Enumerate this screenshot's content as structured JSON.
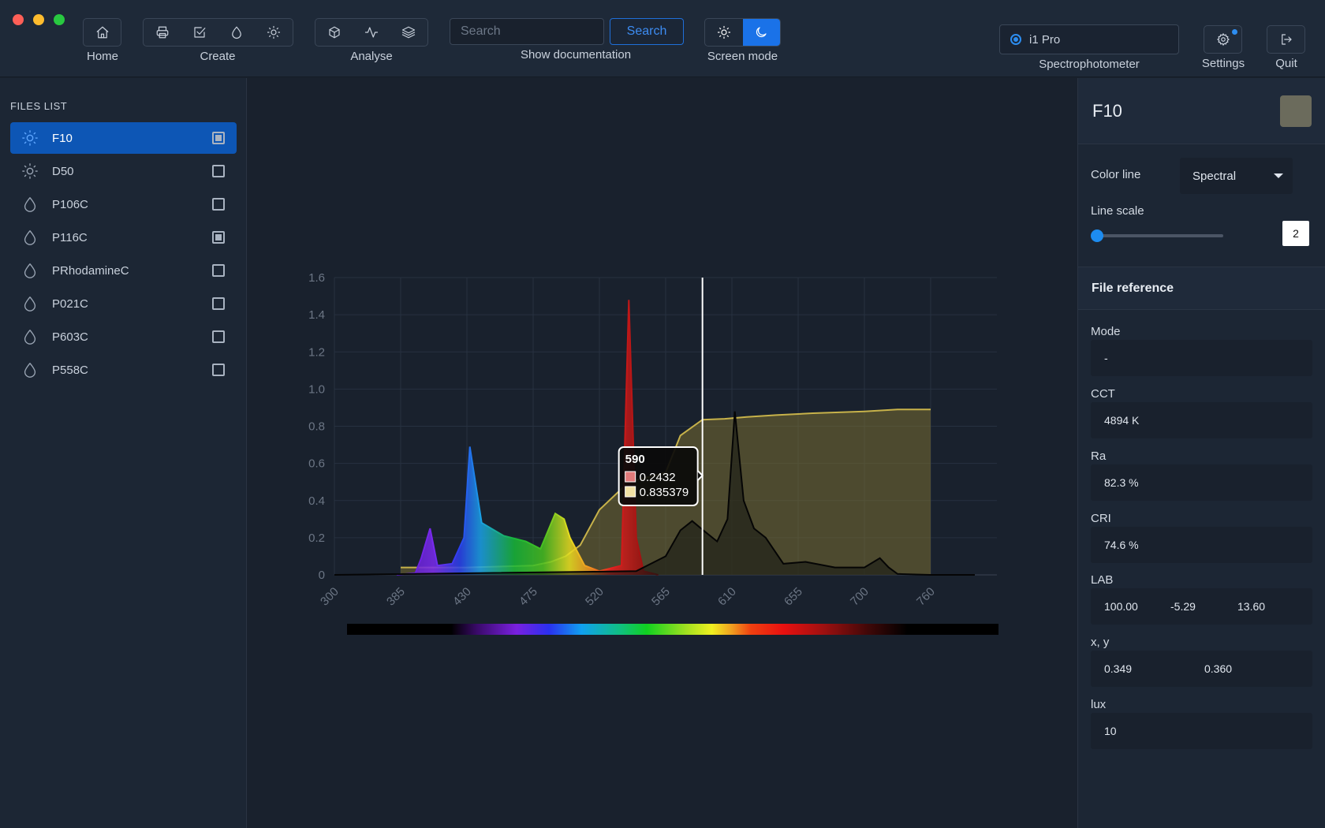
{
  "toolbar": {
    "home_label": "Home",
    "create_label": "Create",
    "analyse_label": "Analyse",
    "search_placeholder": "Search",
    "search_button": "Search",
    "show_doc_label": "Show documentation",
    "screen_mode_label": "Screen mode",
    "device_value": "i1 Pro",
    "device_label": "Spectrophotometer",
    "settings_label": "Settings",
    "quit_label": "Quit"
  },
  "sidebar": {
    "title": "FILES LIST",
    "items": [
      {
        "name": "F10",
        "icon": "sun-icon",
        "checked": true,
        "active": true
      },
      {
        "name": "D50",
        "icon": "sun-icon",
        "checked": false,
        "active": false
      },
      {
        "name": "P106C",
        "icon": "drop-icon",
        "checked": false,
        "active": false
      },
      {
        "name": "P116C",
        "icon": "drop-icon",
        "checked": true,
        "active": false
      },
      {
        "name": "PRhodamineC",
        "icon": "drop-icon",
        "checked": false,
        "active": false
      },
      {
        "name": "P021C",
        "icon": "drop-icon",
        "checked": false,
        "active": false
      },
      {
        "name": "P603C",
        "icon": "drop-icon",
        "checked": false,
        "active": false
      },
      {
        "name": "P558C",
        "icon": "drop-icon",
        "checked": false,
        "active": false
      }
    ]
  },
  "chart_data": {
    "type": "area",
    "x_ticks": [
      "300",
      "385",
      "430",
      "475",
      "520",
      "565",
      "610",
      "655",
      "700",
      "760"
    ],
    "y_ticks": [
      "1.6",
      "1.4",
      "1.2",
      "1.0",
      "0.8",
      "0.6",
      "0.4",
      "0.2",
      "0"
    ],
    "ylim": [
      0,
      1.6
    ],
    "grid": true,
    "series": [
      {
        "color": "#c7b24a",
        "x": [
          385,
          430,
          475,
          487,
          497,
          507,
          520,
          540,
          565,
          575,
          590,
          605,
          620,
          640,
          665,
          700,
          730,
          760
        ],
        "y": [
          0.04,
          0.04,
          0.05,
          0.07,
          0.1,
          0.16,
          0.35,
          0.5,
          0.55,
          0.75,
          0.835379,
          0.84,
          0.85,
          0.86,
          0.87,
          0.88,
          0.89,
          0.89
        ]
      },
      {
        "color": "#000000",
        "x": [
          300,
          545,
          565,
          575,
          583,
          590,
          600,
          607,
          612,
          618,
          625,
          633,
          645,
          660,
          680,
          700,
          714,
          722,
          730,
          760,
          790
        ],
        "y": [
          0,
          0.02,
          0.1,
          0.24,
          0.29,
          0.2432,
          0.18,
          0.3,
          0.88,
          0.4,
          0.25,
          0.2,
          0.06,
          0.07,
          0.04,
          0.04,
          0.09,
          0.04,
          0.005,
          0,
          0
        ]
      },
      {
        "color": "spectral",
        "x": [
          380,
          395,
          399,
          405,
          410,
          420,
          428,
          432,
          440,
          455,
          470,
          480,
          490,
          496,
          500,
          510,
          520,
          535,
          540,
          545,
          550,
          560
        ],
        "y": [
          0,
          0.01,
          0.09,
          0.25,
          0.05,
          0.06,
          0.2,
          0.69,
          0.28,
          0.21,
          0.18,
          0.14,
          0.33,
          0.3,
          0.2,
          0.05,
          0.02,
          0.05,
          1.48,
          0.2,
          0.02,
          0
        ]
      }
    ],
    "tooltip": {
      "x": "590",
      "values": [
        "0.2432",
        "0.835379"
      ],
      "colors": [
        "#e07a7a",
        "#f2e1a4"
      ]
    },
    "cursor_x": 590
  },
  "panel": {
    "title": "F10",
    "swatch_color": "#6b6b5c",
    "color_line_label": "Color line",
    "color_line_value": "Spectral",
    "line_scale_label": "Line scale",
    "line_scale_value": "2",
    "line_scale_level": 0,
    "file_reference": "File reference",
    "mode_label": "Mode",
    "mode_value": "-",
    "cct_label": "CCT",
    "cct_value": "4894 K",
    "ra_label": "Ra",
    "ra_value": "82.3 %",
    "cri_label": "CRI",
    "cri_value": "74.6 %",
    "lab_label": "LAB",
    "lab_l": "100.00",
    "lab_a": "-5.29",
    "lab_b": "13.60",
    "xy_label": "x, y",
    "x_value": "0.349",
    "y_value": "0.360",
    "lux_label": "lux",
    "lux_value": "10"
  }
}
